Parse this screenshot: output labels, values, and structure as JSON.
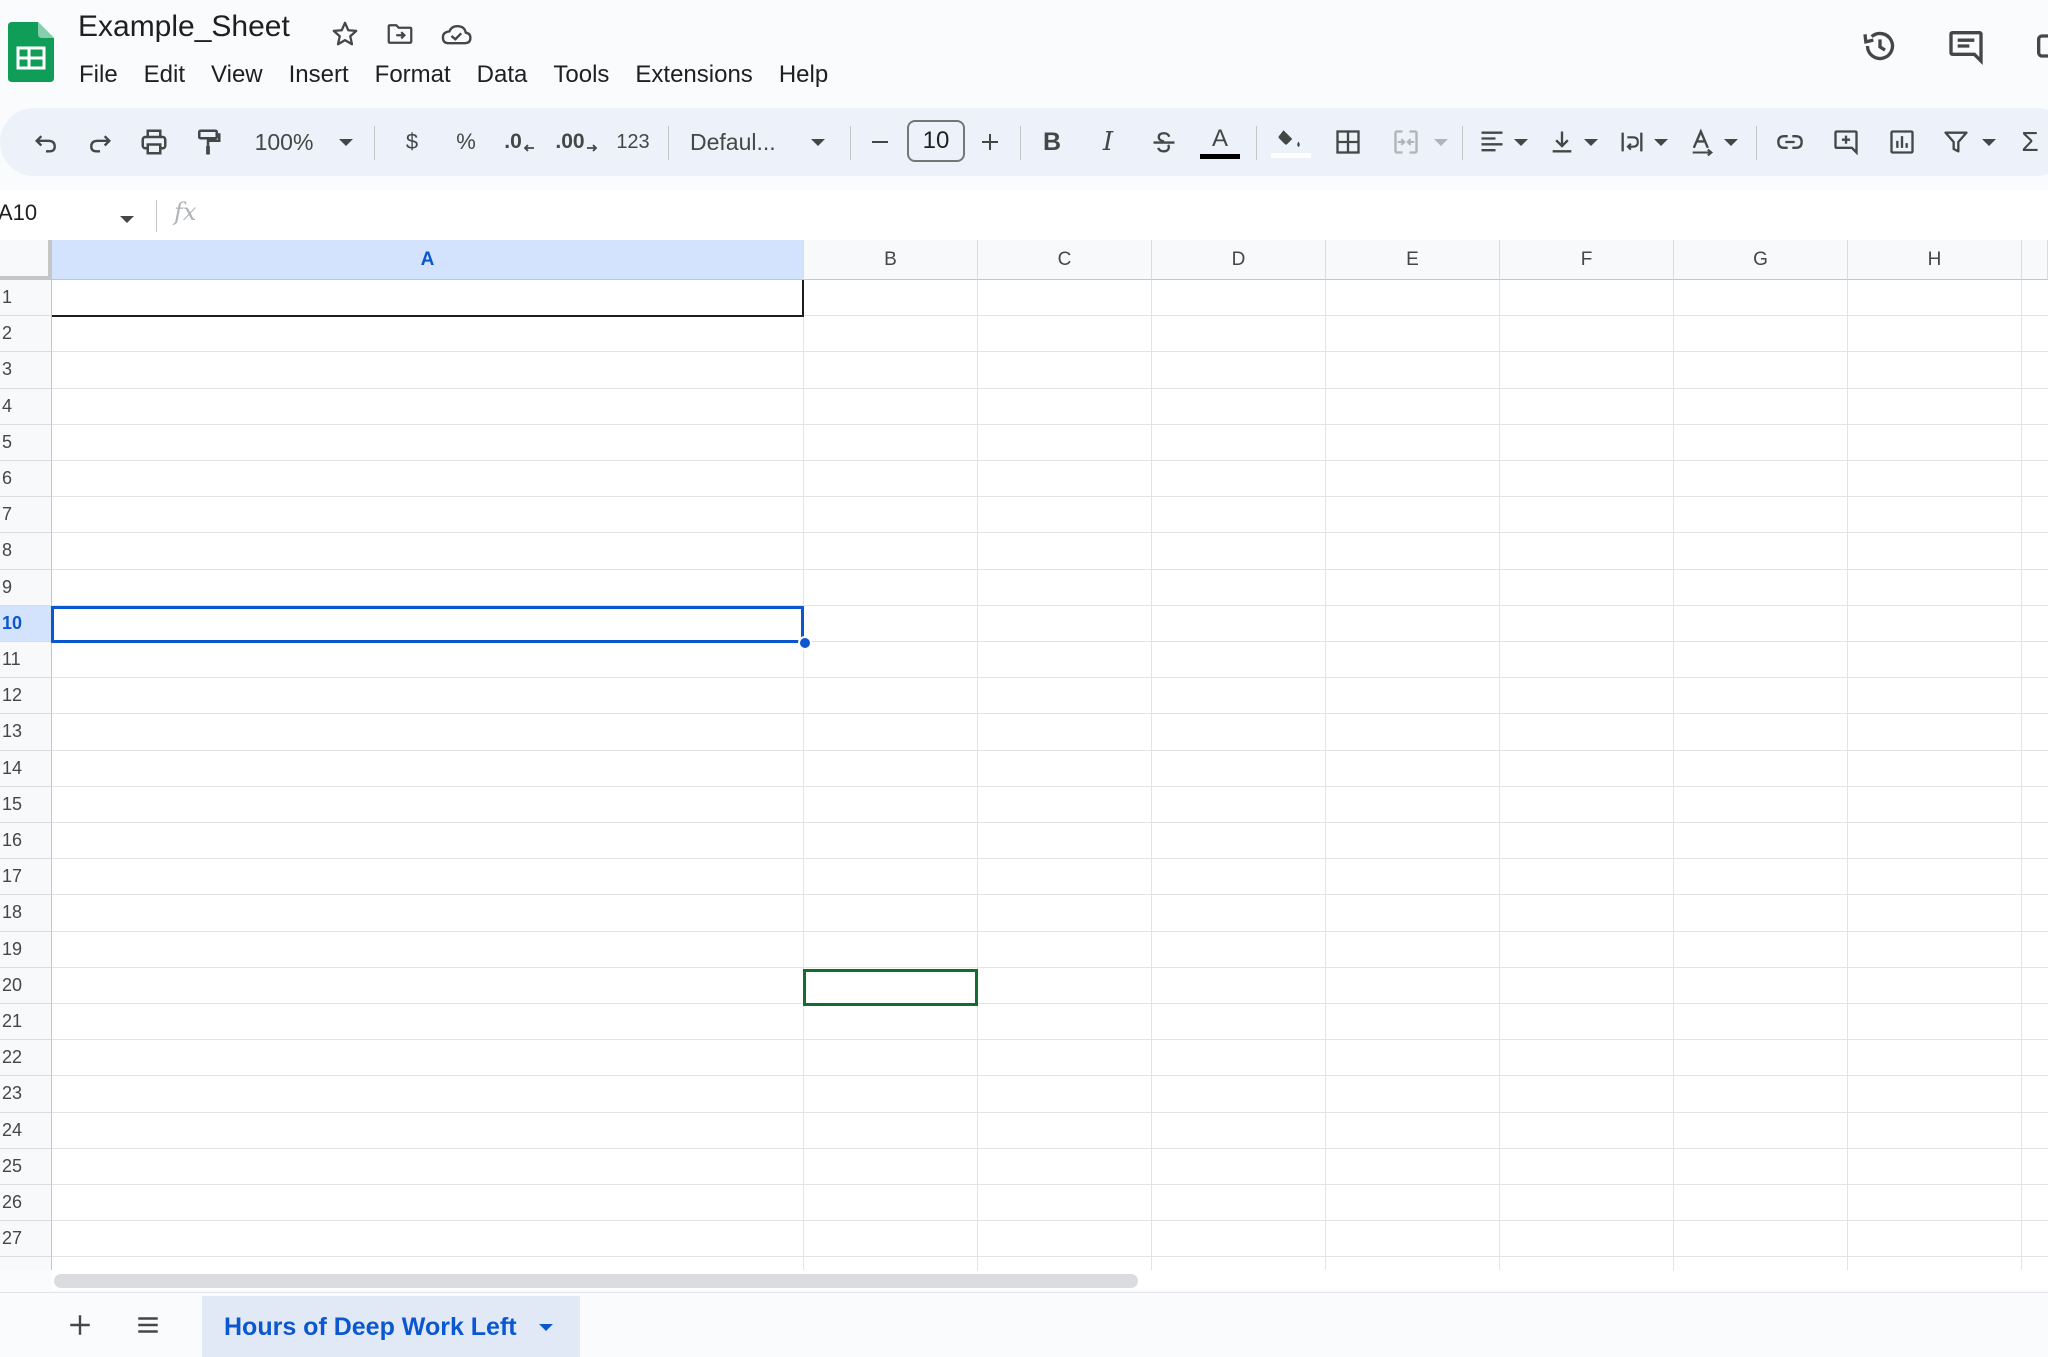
{
  "app": {
    "document_title": "Example_Sheet",
    "brand_color": "#0f9d58",
    "accent_color": "#0b57d0"
  },
  "menu": {
    "items": [
      {
        "label": "File"
      },
      {
        "label": "Edit"
      },
      {
        "label": "View"
      },
      {
        "label": "Insert"
      },
      {
        "label": "Format"
      },
      {
        "label": "Data"
      },
      {
        "label": "Tools"
      },
      {
        "label": "Extensions"
      },
      {
        "label": "Help"
      }
    ]
  },
  "toolbar": {
    "zoom": "100%",
    "currency_label": "$",
    "percent_label": "%",
    "decrease_decimal_label": ".0",
    "increase_decimal_label": ".00",
    "more_formats_label": "123",
    "font_family": "Defaul...",
    "font_size": "10",
    "bold_label": "B",
    "italic_label": "I",
    "text_color_label": "A"
  },
  "formula_bar": {
    "name_box": "A10",
    "fx_label": "fx",
    "formula_value": ""
  },
  "grid": {
    "columns": [
      "A",
      "B",
      "C",
      "D",
      "E",
      "F",
      "G",
      "H"
    ],
    "active_column": "A",
    "rows": [
      "1",
      "2",
      "3",
      "4",
      "5",
      "6",
      "7",
      "8",
      "9",
      "10",
      "11",
      "12",
      "13",
      "14",
      "15",
      "16",
      "17",
      "18",
      "19",
      "20",
      "21",
      "22",
      "23",
      "24",
      "25",
      "26",
      "27"
    ],
    "active_row": "10",
    "selected_cell": "A10",
    "selection_color": "#0b57d0",
    "highlighted_cell": "B20",
    "highlight_color": "#146c2e"
  },
  "sheets": {
    "tabs": [
      {
        "label": "Hours of Deep Work Left",
        "active": true
      }
    ]
  }
}
